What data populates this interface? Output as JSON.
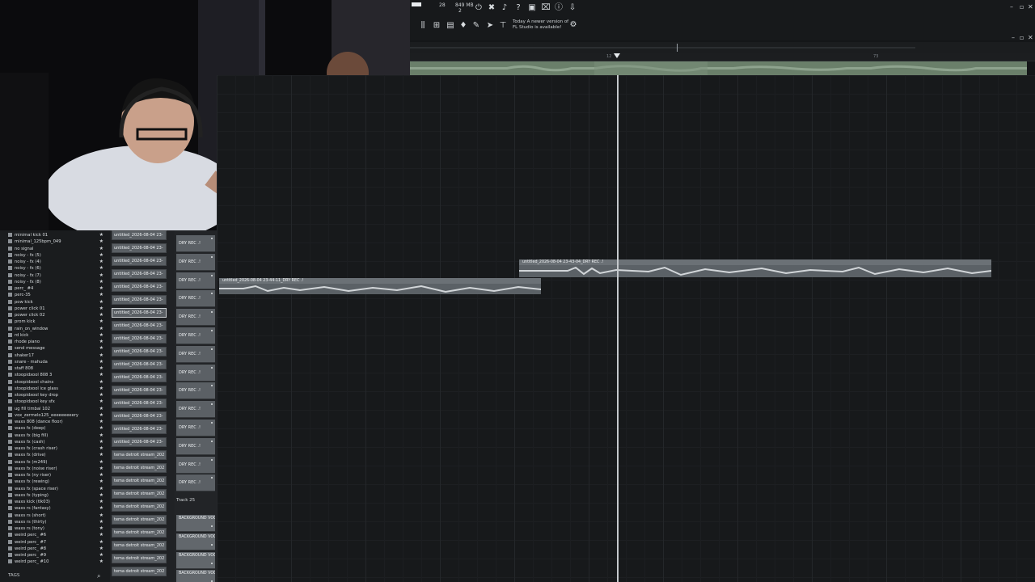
{
  "toolbar": {
    "tempo_num": "28",
    "memory": "849 MB",
    "memory_sub": "2",
    "hint_line1": "Today A newer version of",
    "hint_line2": "FL Studio is available!",
    "icons": [
      "panic-icon",
      "metronome-icon",
      "mic-icon",
      "help-icon",
      "save-icon",
      "info-icon",
      "download-icon",
      "mixer-icon",
      "channel-rack-icon",
      "piano-roll-icon",
      "plugin-icon",
      "brush-icon",
      "tools-icon",
      "mini-icon"
    ]
  },
  "ruler": {
    "marks": [
      "12",
      "73"
    ]
  },
  "browser": {
    "items": [
      "minimal kick 01",
      "minimal_125bpm_049",
      "no signal",
      "noisy - fx (5)",
      "noisy - fx (4)",
      "noisy - fx (6)",
      "noisy - fx (7)",
      "noisy - fx (8)",
      "perc_ #4",
      "perc-35",
      "pow kick",
      "power click 01",
      "power click 02",
      "prom kick",
      "rain_on_window",
      "rd kick",
      "rhode piano",
      "send message",
      "shaker17",
      "snare - mahuda",
      "staff 808",
      "stoopidxool 808 3",
      "stoopidxool chains",
      "stoopidxool ice glass",
      "stoopidxool key drop",
      "stoopidxool key sfx",
      "ug fill timbal 102",
      "vox_zermelo125_eeeeeeeeery",
      "waxs 808 (dance floor)",
      "waxs fx (deep)",
      "waxs fx (big fill)",
      "waxs fx (cash)",
      "waxs fx (crash riser)",
      "waxs fx (drive)",
      "waxs fx (m249)",
      "waxs fx (noise riser)",
      "waxs fx (ny riser)",
      "waxs fx (rewing)",
      "waxs fx (space riser)",
      "waxs fx (typing)",
      "waxs kick (tlk03)",
      "waxs rs (fantasy)",
      "waxs rs (short)",
      "waxs rs (thirty)",
      "waxs rs (tony)",
      "weird perc_ #6",
      "weird perc_ #7",
      "weird perc_ #8",
      "weird perc_ #9",
      "weird perc_ #10"
    ],
    "tags": "TAGS"
  },
  "clips": [
    "untitled_2026-08-04 23-",
    "untitled_2026-08-04 23-",
    "untitled_2026-08-04 23-",
    "untitled_2026-08-04 23-",
    "untitled_2026-08-04 23-",
    "untitled_2026-08-04 23-",
    "untitled_2026-08-04 23-",
    "untitled_2026-08-04 23-",
    "untitled_2026-08-04 23-",
    "untitled_2026-08-04 23-",
    "untitled_2026-08-04 23-",
    "untitled_2026-08-04 23-",
    "untitled_2026-08-04 23-",
    "untitled_2026-08-04 23-",
    "untitled_2026-08-04 23-",
    "untitled_2026-08-04 23-",
    "untitled_2026-08-04 23-",
    "tema detroit stream_202",
    "tema detroit stream_202",
    "tema detroit stream_202",
    "tema detroit stream_202",
    "tema detroit stream_202",
    "tema detroit stream_202",
    "tema detroit stream_202",
    "tema detroit stream_202",
    "tema detroit stream_202",
    "tema detroit stream_202"
  ],
  "tracks": [
    "DRY REC .!",
    "DRY REC .!",
    "DRY REC .!",
    "DRY REC .!",
    "DRY REC .!",
    "DRY REC .!",
    "DRY REC .!",
    "DRY REC .!",
    "DRY REC .!",
    "DRY REC .!",
    "DRY REC .!",
    "DRY REC .!",
    "DRY REC .!",
    "DRY REC .!"
  ],
  "track25": "Track 25",
  "bg_tracks": [
    "BACKGROUND VOCAL",
    "BACKGROUND VOCAL",
    "BACKGROUND VOCAL",
    "BACKGROUND VOCAL"
  ],
  "audio_clips": [
    {
      "title": "untitled_2026-08-04 23-43-04_DRY REC .!"
    },
    {
      "title": "untitled_2026-08-04 23-44-11_DRY REC .!"
    }
  ]
}
